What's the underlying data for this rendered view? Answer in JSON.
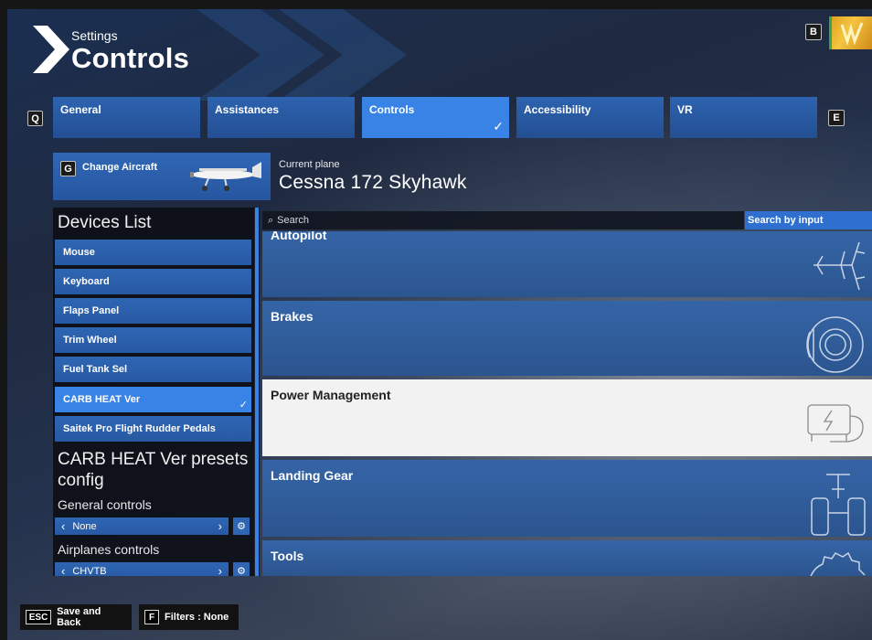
{
  "header": {
    "supertitle": "Settings",
    "title": "Controls",
    "key_b": "B",
    "key_q": "Q",
    "key_e": "E"
  },
  "tabs": [
    {
      "label": "General",
      "active": false
    },
    {
      "label": "Assistances",
      "active": false
    },
    {
      "label": "Controls",
      "active": true
    },
    {
      "label": "Accessibility",
      "active": false
    },
    {
      "label": "VR",
      "active": false
    }
  ],
  "aircraft": {
    "key": "G",
    "change_label": "Change Aircraft",
    "current_label": "Current plane",
    "current_value": "Cessna 172 Skyhawk"
  },
  "devices": {
    "title": "Devices List",
    "items": [
      {
        "label": "Mouse",
        "active": false
      },
      {
        "label": "Keyboard",
        "active": false
      },
      {
        "label": "Flaps Panel",
        "active": false
      },
      {
        "label": "Trim Wheel",
        "active": false
      },
      {
        "label": "Fuel Tank Sel",
        "active": false
      },
      {
        "label": "CARB HEAT Ver",
        "active": true
      },
      {
        "label": "Saitek Pro Flight Rudder Pedals",
        "active": false
      }
    ],
    "presets_title": "CARB HEAT Ver presets config",
    "general_controls_label": "General controls",
    "general_controls_value": "None",
    "airplanes_controls_label": "Airplanes controls",
    "airplanes_controls_value": "CHVTB"
  },
  "search": {
    "placeholder": "Search",
    "search_by_input": "Search by input"
  },
  "categories": [
    {
      "label": "Autopilot",
      "icon": "airplane-icon",
      "highlighted": false
    },
    {
      "label": "Brakes",
      "icon": "brake-disc-icon",
      "highlighted": false
    },
    {
      "label": "Power Management",
      "icon": "battery-icon",
      "highlighted": true
    },
    {
      "label": "Landing Gear",
      "icon": "landing-gear-icon",
      "highlighted": false
    },
    {
      "label": "Tools",
      "icon": "gear-icon",
      "highlighted": false
    }
  ],
  "footer": {
    "back_key": "ESC",
    "back_label": "Save and Back",
    "filters_key": "F",
    "filters_label": "Filters : None"
  },
  "colors": {
    "accent": "#3a83e6",
    "tab_blue": "#2d63b0",
    "highlight": "#f2f2f2"
  }
}
